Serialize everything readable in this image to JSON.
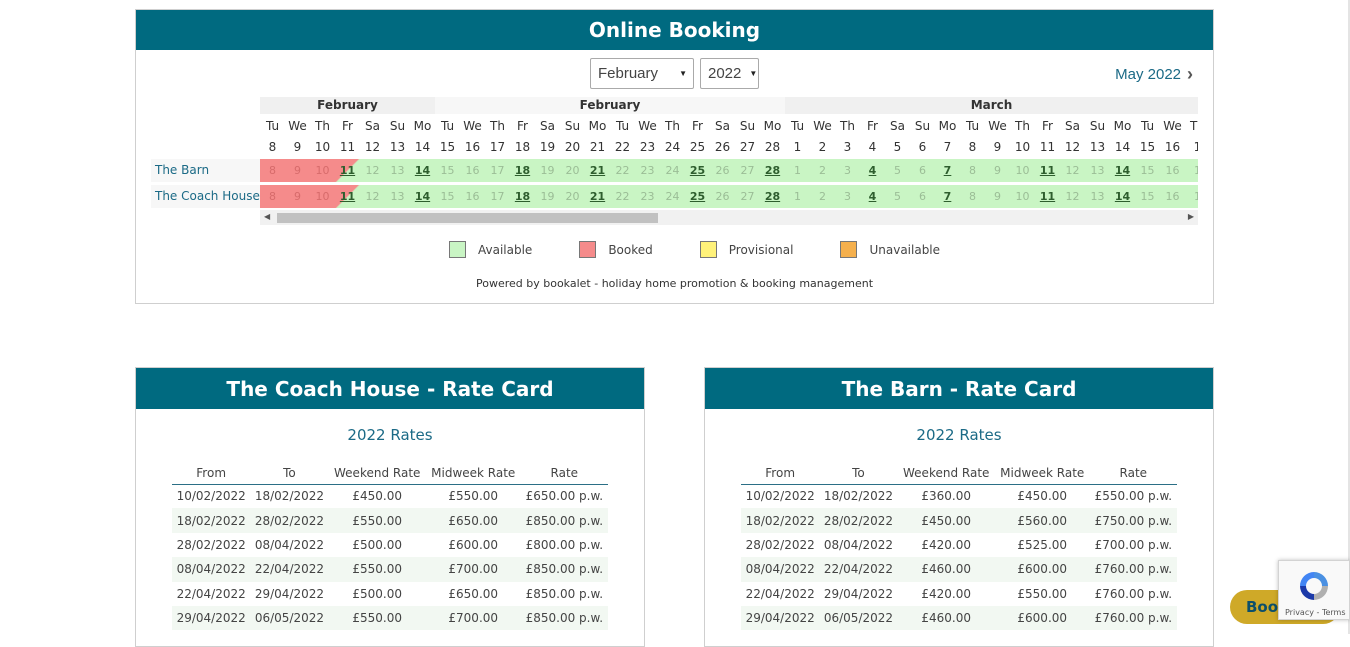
{
  "booking": {
    "title": "Online Booking",
    "month_select": "February",
    "year_select": "2022",
    "next_link": "May 2022",
    "months": [
      {
        "label": "February"
      },
      {
        "label": "February"
      },
      {
        "label": "March"
      }
    ],
    "dow": [
      "Tu",
      "We",
      "Th",
      "Fr",
      "Sa",
      "Su",
      "Mo",
      "Tu",
      "We",
      "Th",
      "Fr",
      "Sa",
      "Su",
      "Mo",
      "Tu",
      "We",
      "Th",
      "Fr",
      "Sa",
      "Su",
      "Mo",
      "Tu",
      "We",
      "Th",
      "Fr",
      "Sa",
      "Su",
      "Mo",
      "Tu",
      "We",
      "Th",
      "Fr",
      "Sa",
      "Su",
      "Mo",
      "Tu",
      "We",
      "Th",
      "Fr",
      "Sa",
      "Su",
      "Mo",
      "Tu",
      "We",
      "T"
    ],
    "days": [
      "8",
      "9",
      "10",
      "11",
      "12",
      "13",
      "14",
      "15",
      "16",
      "17",
      "18",
      "19",
      "20",
      "21",
      "22",
      "23",
      "24",
      "25",
      "26",
      "27",
      "28",
      "1",
      "2",
      "3",
      "4",
      "5",
      "6",
      "7",
      "8",
      "9",
      "10",
      "11",
      "12",
      "13",
      "14",
      "15",
      "16",
      "1"
    ],
    "properties": [
      {
        "name": "The Barn"
      },
      {
        "name": "The Coach House"
      }
    ],
    "availability_days": [
      "8",
      "9",
      "10",
      "11",
      "12",
      "13",
      "14",
      "15",
      "16",
      "17",
      "18",
      "19",
      "20",
      "21",
      "22",
      "23",
      "24",
      "25",
      "26",
      "27",
      "28",
      "1",
      "2",
      "3",
      "4",
      "5",
      "6",
      "7",
      "8",
      "9",
      "10",
      "11",
      "12",
      "13",
      "14",
      "15",
      "16",
      "1"
    ],
    "legend": {
      "available": "Available",
      "booked": "Booked",
      "provisional": "Provisional",
      "unavailable": "Unavailable"
    },
    "legend_colors": {
      "available": "#c9f5c4",
      "booked": "#f58b8b",
      "provisional": "#fff27a",
      "unavailable": "#f5b04d"
    },
    "powered_by": "Powered by bookalet - holiday home promotion & booking management"
  },
  "rate_cards": [
    {
      "title": "The Coach House - Rate Card",
      "year_label": "2022 Rates",
      "columns": [
        "From",
        "To",
        "Weekend Rate",
        "Midweek Rate",
        "Rate"
      ],
      "rows": [
        [
          "10/02/2022",
          "18/02/2022",
          "£450.00",
          "£550.00",
          "£650.00 p.w."
        ],
        [
          "18/02/2022",
          "28/02/2022",
          "£550.00",
          "£650.00",
          "£850.00 p.w."
        ],
        [
          "28/02/2022",
          "08/04/2022",
          "£500.00",
          "£600.00",
          "£800.00 p.w."
        ],
        [
          "08/04/2022",
          "22/04/2022",
          "£550.00",
          "£700.00",
          "£850.00 p.w."
        ],
        [
          "22/04/2022",
          "29/04/2022",
          "£500.00",
          "£650.00",
          "£850.00 p.w."
        ],
        [
          "29/04/2022",
          "06/05/2022",
          "£550.00",
          "£700.00",
          "£850.00 p.w."
        ]
      ]
    },
    {
      "title": "The Barn - Rate Card",
      "year_label": "2022 Rates",
      "columns": [
        "From",
        "To",
        "Weekend Rate",
        "Midweek Rate",
        "Rate"
      ],
      "rows": [
        [
          "10/02/2022",
          "18/02/2022",
          "£360.00",
          "£450.00",
          "£550.00 p.w."
        ],
        [
          "18/02/2022",
          "28/02/2022",
          "£450.00",
          "£560.00",
          "£750.00 p.w."
        ],
        [
          "28/02/2022",
          "08/04/2022",
          "£420.00",
          "£525.00",
          "£700.00 p.w."
        ],
        [
          "08/04/2022",
          "22/04/2022",
          "£460.00",
          "£600.00",
          "£760.00 p.w."
        ],
        [
          "22/04/2022",
          "29/04/2022",
          "£420.00",
          "£550.00",
          "£760.00 p.w."
        ],
        [
          "29/04/2022",
          "06/05/2022",
          "£460.00",
          "£600.00",
          "£760.00 p.w."
        ]
      ]
    }
  ],
  "floating": {
    "book_button": "Book",
    "recaptcha_text": "Privacy - Terms"
  }
}
